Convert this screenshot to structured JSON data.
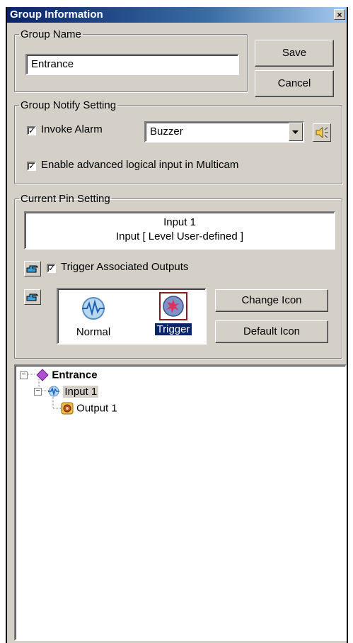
{
  "window": {
    "title": "Group Information",
    "close_glyph": "×"
  },
  "group_name": {
    "legend": "Group Name",
    "value": "Entrance",
    "save_label": "Save",
    "cancel_label": "Cancel"
  },
  "notify": {
    "legend": "Group Notify Setting",
    "invoke_alarm_label": "Invoke Alarm",
    "invoke_alarm_checked": true,
    "alarm_selected": "Buzzer",
    "advanced_label": "Enable advanced logical input in Multicam",
    "advanced_checked": true,
    "speaker_icon": "speaker-icon"
  },
  "pin": {
    "legend": "Current Pin Setting",
    "info_line1": "Input 1",
    "info_line2": "Input [ Level User-defined ]",
    "trigger_outputs_label": "Trigger Associated Outputs",
    "trigger_outputs_checked": true,
    "normal_label": "Normal",
    "trigger_label": "Trigger",
    "change_icon_label": "Change Icon",
    "default_icon_label": "Default Icon"
  },
  "tree": {
    "root": "Entrance",
    "child": "Input 1",
    "grandchild": "Output 1"
  },
  "colors": {
    "accent": "#0a246a",
    "face": "#d4d0c8"
  }
}
